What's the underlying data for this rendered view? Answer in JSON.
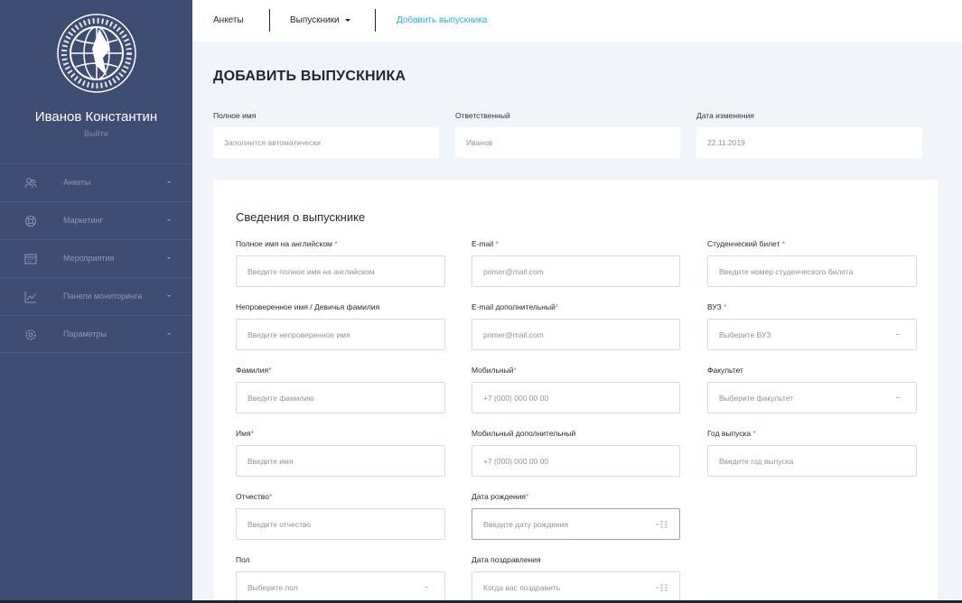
{
  "sidebar": {
    "logo_text": "АССОЦИАЦИЯ ВЫПУСКНИКОВ ВСЕМИРНАЯ",
    "user_name": "Иванов Константин",
    "logout": "Выйти",
    "items": [
      {
        "label": "Анкеты",
        "icon": "users-icon"
      },
      {
        "label": "Маркетинг",
        "icon": "lifebuoy-icon"
      },
      {
        "label": "Мероприятия",
        "icon": "calendar-icon"
      },
      {
        "label": "Панели мониторинга",
        "icon": "chart-icon"
      },
      {
        "label": "Параметры",
        "icon": "gear-icon"
      }
    ]
  },
  "topbar": {
    "forms": "Анкеты",
    "graduates": "Выпускники",
    "add_graduate": "Добавить выпускника"
  },
  "page": {
    "title": "ДОБАВИТЬ ВЫПУСКНИКА",
    "meta": {
      "full_name_label": "Полное имя",
      "full_name_value": "Заполнится автоматически",
      "responsible_label": "Ответственный",
      "responsible_value": "Иванов",
      "modified_label": "Дата изменения",
      "modified_value": "22.11.2019"
    }
  },
  "form": {
    "section_title": "Сведения о выпускнике",
    "fields": {
      "name_en": {
        "label": "Полное имя на английском",
        "placeholder": "Введите полное имя на английском"
      },
      "email": {
        "label": "E-mail",
        "placeholder": "primer@mail.com"
      },
      "student_card": {
        "label": "Студенческий билет",
        "placeholder": "Введите номер студенческого билета"
      },
      "unverified_name": {
        "label": "Непроверенное имя / Девичья фамилия",
        "placeholder": "Введите непроверенное имя"
      },
      "email_extra": {
        "label": "E-mail дополнительный",
        "placeholder": "primer@mail.com"
      },
      "university": {
        "label": "ВУЗ",
        "placeholder": "Выберите ВУЗ"
      },
      "surname": {
        "label": "Фамилия",
        "placeholder": "Введите фамилию"
      },
      "mobile": {
        "label": "Мобильный",
        "placeholder": "+7 (000) 000 00 00"
      },
      "faculty": {
        "label": "Факультет",
        "placeholder": "Выберите факультет"
      },
      "first_name": {
        "label": "Имя",
        "placeholder": "Введите имя"
      },
      "mobile_extra": {
        "label": "Мобильный дополнительный",
        "placeholder": "+7 (000) 000 00 00"
      },
      "grad_year": {
        "label": "Год выпуска",
        "placeholder": "Введите год выпуска"
      },
      "patronymic": {
        "label": "Отчество",
        "placeholder": "Введите отчество"
      },
      "birth_date": {
        "label": "Дата рождения",
        "placeholder": "Введите дату рождения"
      },
      "gender": {
        "label": "Пол",
        "placeholder": "Выберите пол"
      },
      "congrats_date": {
        "label": "Дата поздравления",
        "placeholder": "Когда вас поздравить"
      }
    },
    "required_mark": "*"
  },
  "colors": {
    "sidebar_bg": "#3e4d72",
    "accent": "#22b3d8",
    "required_red": "#e34b4b"
  }
}
